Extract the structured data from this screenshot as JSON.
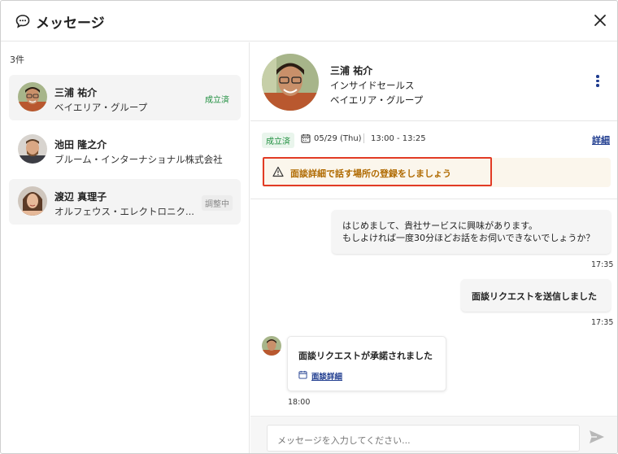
{
  "header": {
    "title": "メッセージ",
    "icon": "chat-bubble-icon",
    "close_icon": "close-icon"
  },
  "sidebar": {
    "count": "3件",
    "items": [
      {
        "name": "三浦 祐介",
        "company": "ベイエリア・グループ",
        "badge": "成立済",
        "badge_color": "#1e8e3e",
        "selected": true
      },
      {
        "name": "池田 隆之介",
        "company": "ブルーム・インターナショナル株式会社",
        "badge": ""
      },
      {
        "name": "渡辺 真理子",
        "company": "オルフェウス・エレクトロニク...",
        "badge": "調整中",
        "badge_color": "#888888"
      }
    ]
  },
  "profile": {
    "name": "三浦 祐介",
    "title": "インサイドセールス",
    "company": "ベイエリア・グループ"
  },
  "meeting": {
    "status": "成立済",
    "date": "05/29 (Thu)",
    "time": "13:00 - 13:25",
    "detail_link": "詳細",
    "warning": "面談詳細で話す場所の登録をしましょう",
    "warning_color": "#b06a00"
  },
  "messages": {
    "m1_line1": "はじめまして、貴社サービスに興味があります。",
    "m1_line2": "もしよければ一度30分ほどお話をお伺いできないでしょうか？",
    "m1_time": "17:35",
    "m2_text": "面談リクエストを送信しました",
    "m2_time": "17:35",
    "m3_text": "面談リクエストが承諾されました",
    "m3_link": "面談詳細",
    "m3_time": "18:00"
  },
  "compose": {
    "placeholder": "メッセージを入力してください...",
    "send_icon": "send-icon"
  },
  "colors": {
    "accent": "#1f3c8f",
    "highlight_border": "#e23b25",
    "success": "#1e8e3e"
  }
}
